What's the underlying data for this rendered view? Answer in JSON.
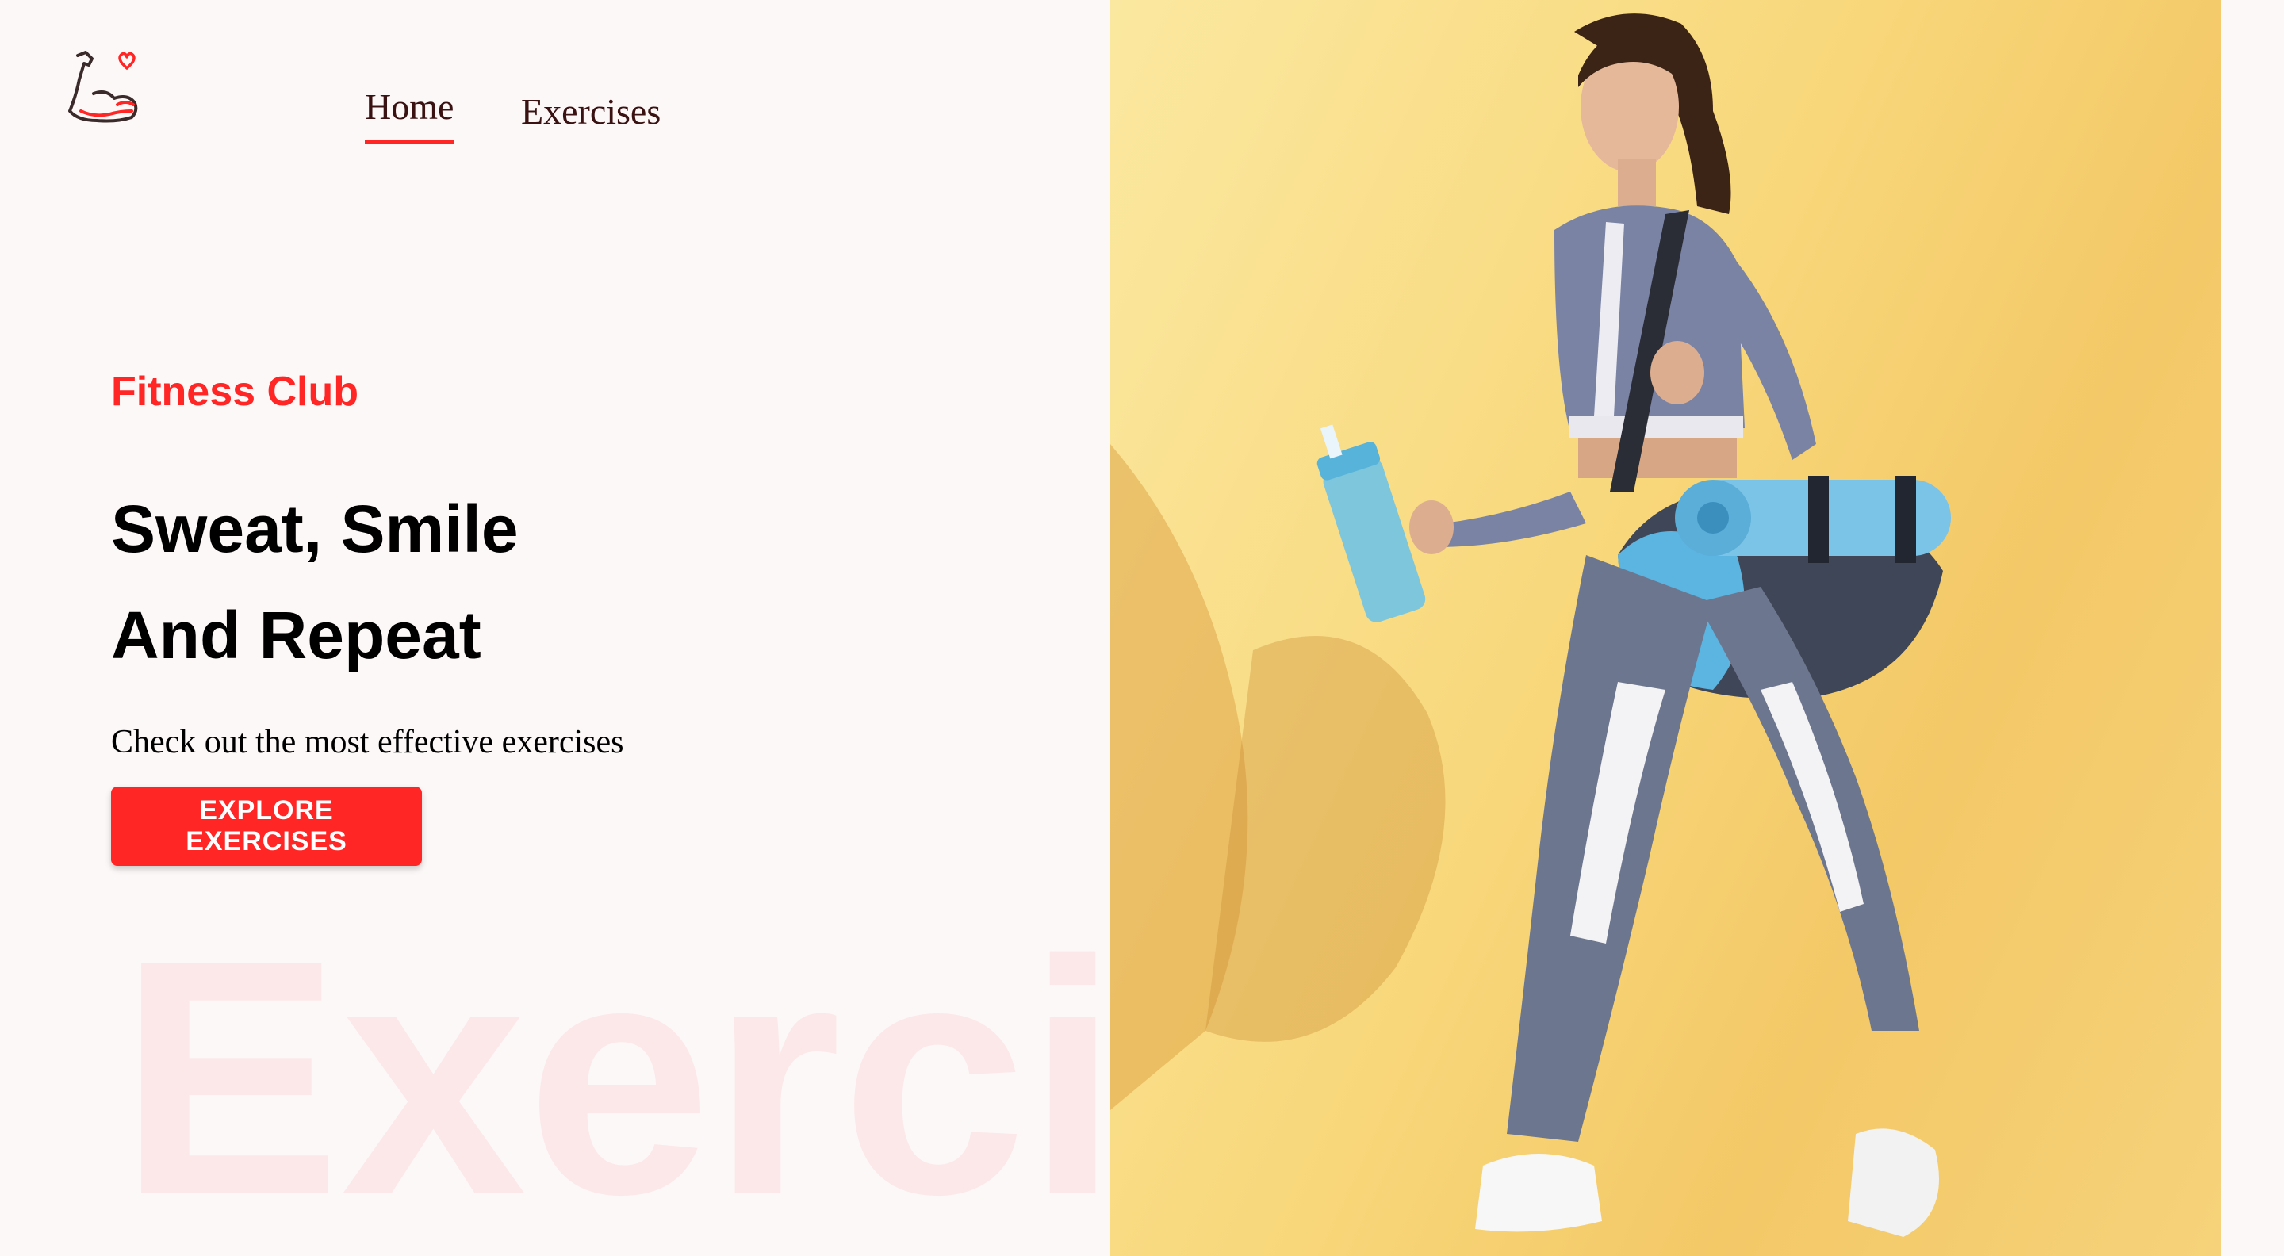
{
  "nav": {
    "links": [
      {
        "label": "Home",
        "active": true
      },
      {
        "label": "Exercises",
        "active": false
      }
    ]
  },
  "hero": {
    "kicker": "Fitness Club",
    "headline_line1": "Sweat, Smile",
    "headline_line2": "And Repeat",
    "subtitle": "Check out the most effective exercises",
    "cta_label": "EXPLORE EXERCISES",
    "watermark": "Exercises"
  },
  "colors": {
    "accent": "#ff2625",
    "background": "#fcf8f8",
    "hero_bg": "#f8d77a"
  }
}
